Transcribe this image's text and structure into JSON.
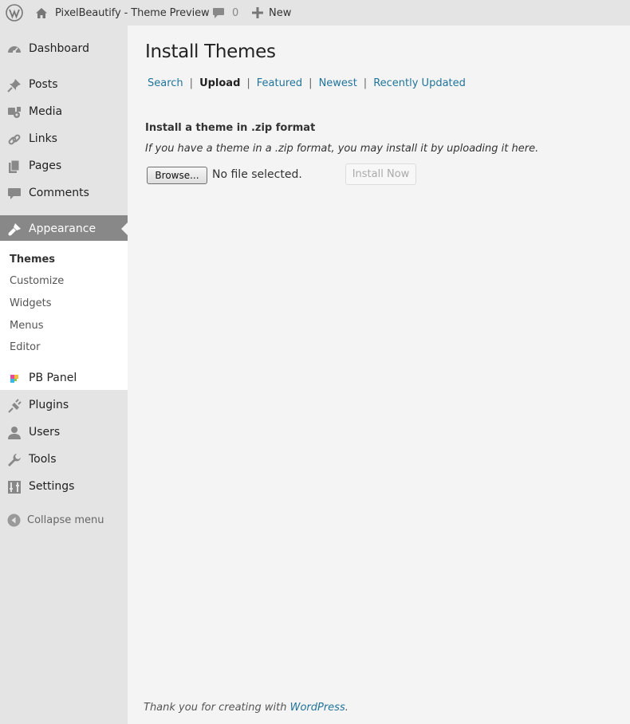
{
  "admin_bar": {
    "site_name": "PixelBeautify - Theme Preview",
    "comments_count": "0",
    "new_label": "New"
  },
  "sidebar": {
    "items": [
      {
        "label": "Dashboard",
        "icon": "dashboard-icon"
      },
      {
        "label": "Posts",
        "icon": "pushpin-icon"
      },
      {
        "label": "Media",
        "icon": "media-icon"
      },
      {
        "label": "Links",
        "icon": "link-icon"
      },
      {
        "label": "Pages",
        "icon": "pages-icon"
      },
      {
        "label": "Comments",
        "icon": "comment-icon"
      },
      {
        "label": "Appearance",
        "icon": "paintbrush-icon"
      },
      {
        "label": "PB Panel",
        "icon": "pb-panel-icon"
      },
      {
        "label": "Plugins",
        "icon": "plugin-icon"
      },
      {
        "label": "Users",
        "icon": "user-icon"
      },
      {
        "label": "Tools",
        "icon": "wrench-icon"
      },
      {
        "label": "Settings",
        "icon": "settings-icon"
      }
    ],
    "submenu": [
      "Themes",
      "Customize",
      "Widgets",
      "Menus",
      "Editor"
    ],
    "collapse_label": "Collapse menu"
  },
  "main": {
    "title": "Install Themes",
    "subnav": [
      "Search",
      "Upload",
      "Featured",
      "Newest",
      "Recently Updated"
    ],
    "section_title": "Install a theme in .zip format",
    "description": "If you have a theme in a .zip format, you may install it by uploading it here.",
    "browse_label": "Browse...",
    "file_status": "No file selected.",
    "install_label": "Install Now"
  },
  "footer": {
    "text": "Thank you for creating with",
    "link": "WordPress",
    "end": "."
  },
  "colors": {
    "link": "#21759b",
    "current_menu_bg": "#888888",
    "sidebar_bg": "#e4e4e4",
    "content_bg": "#f4f4f4"
  }
}
